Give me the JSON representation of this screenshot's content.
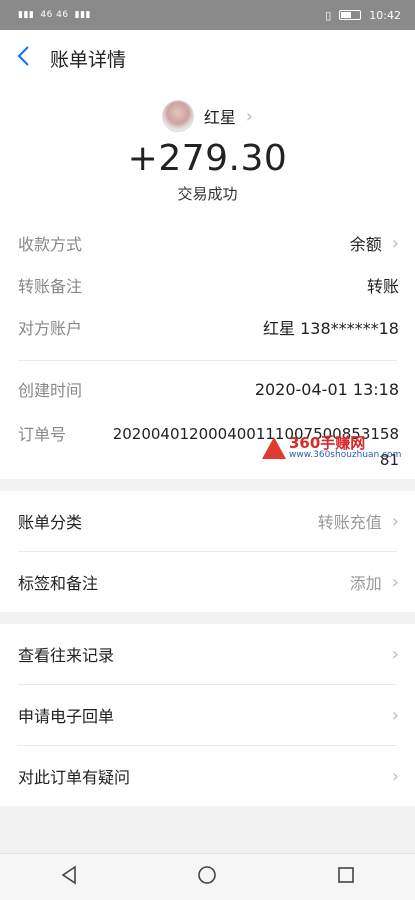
{
  "status": {
    "left": "46 46",
    "time": "10:42"
  },
  "header": {
    "back_icon": "chevron-left-icon",
    "title": "账单详情"
  },
  "summary": {
    "name": "红星",
    "amount": "+279.30",
    "state": "交易成功"
  },
  "details": [
    {
      "label": "收款方式",
      "value": "余额",
      "chevron": true
    },
    {
      "label": "转账备注",
      "value": "转账",
      "chevron": false
    },
    {
      "label": "对方账户",
      "value": "红星 138******18",
      "chevron": false
    }
  ],
  "meta": [
    {
      "label": "创建时间",
      "value": "2020-04-01 13:18"
    },
    {
      "label": "订单号",
      "value": "20200401200040011100750085315881"
    }
  ],
  "actions1": [
    {
      "label": "账单分类",
      "value": "转账充值"
    },
    {
      "label": "标签和备注",
      "value": "添加"
    }
  ],
  "actions2": [
    {
      "label": "查看往来记录"
    },
    {
      "label": "申请电子回单"
    },
    {
      "label": "对此订单有疑问"
    }
  ],
  "watermark": {
    "line1": "360手赚网",
    "line2": "www.360shouzhuan.com"
  }
}
